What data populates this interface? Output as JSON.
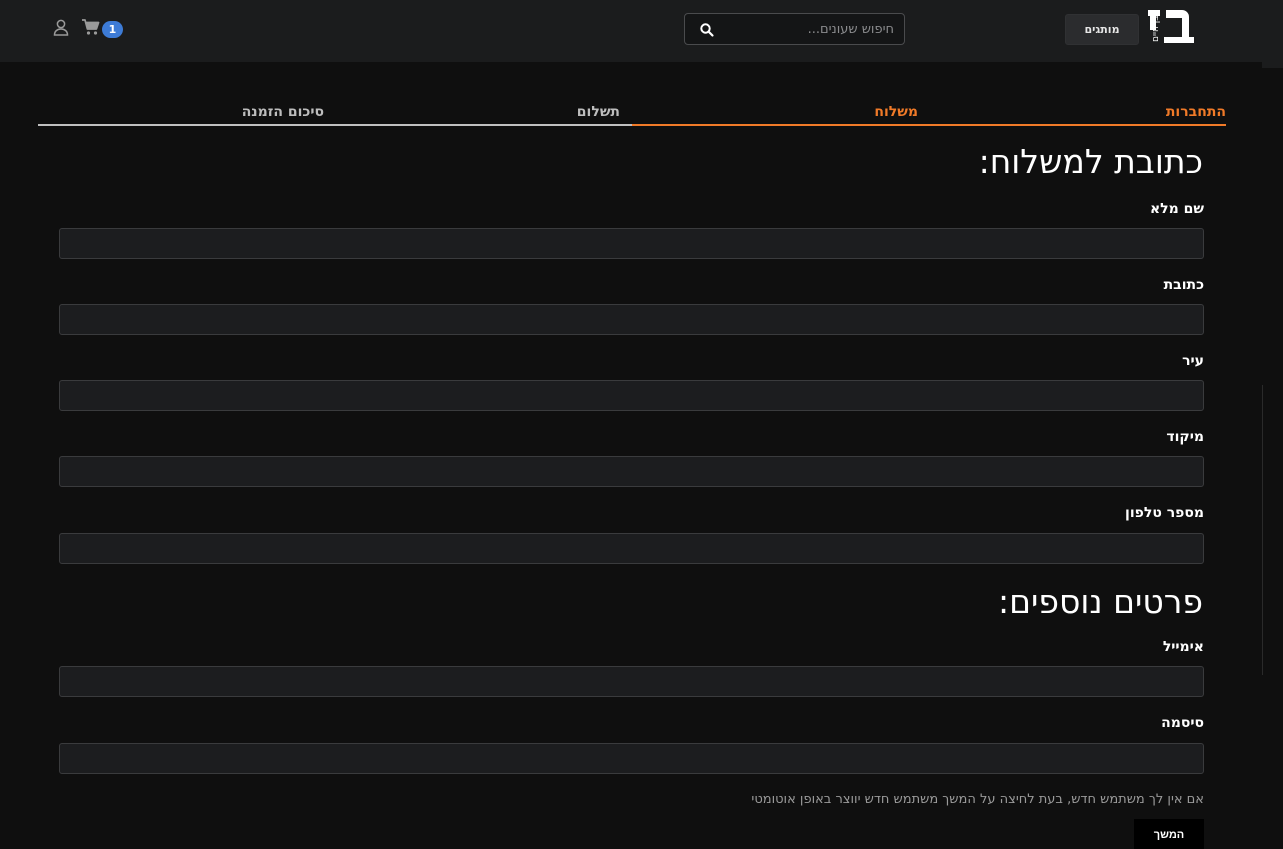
{
  "header": {
    "logo_text": "בן חיים",
    "brands_label": "מותגים",
    "search": {
      "placeholder": "חיפוש שעונים..."
    },
    "cart_count": "1",
    "colors": {
      "bg": "#1b1c1d",
      "badge": "#3d7bd6"
    }
  },
  "steps": [
    {
      "label": "התחברות",
      "state": "done"
    },
    {
      "label": "משלוח",
      "state": "active"
    },
    {
      "label": "תשלום",
      "state": "pending"
    },
    {
      "label": "סיכום הזמנה",
      "state": "pending"
    }
  ],
  "shipping": {
    "title": "כתובת למשלוח:",
    "fields": [
      {
        "label": "שם מלא",
        "value": ""
      },
      {
        "label": "כתובת",
        "value": ""
      },
      {
        "label": "עיר",
        "value": ""
      },
      {
        "label": "מיקוד",
        "value": ""
      },
      {
        "label": "מספר טלפון",
        "value": ""
      }
    ]
  },
  "extra": {
    "title": "פרטים נוספים:",
    "fields": [
      {
        "label": "אימייל",
        "value": ""
      },
      {
        "label": "סיסמה",
        "value": ""
      }
    ],
    "note": "אם אין לך משתמש חדש, בעת לחיצה על המשך משתמש חדש יווצר באופן אוטומטי",
    "continue_label": "המשך"
  },
  "colors": {
    "accent": "#f07a28",
    "background": "#0f0f0f",
    "input_bg": "#1c1d1f"
  }
}
